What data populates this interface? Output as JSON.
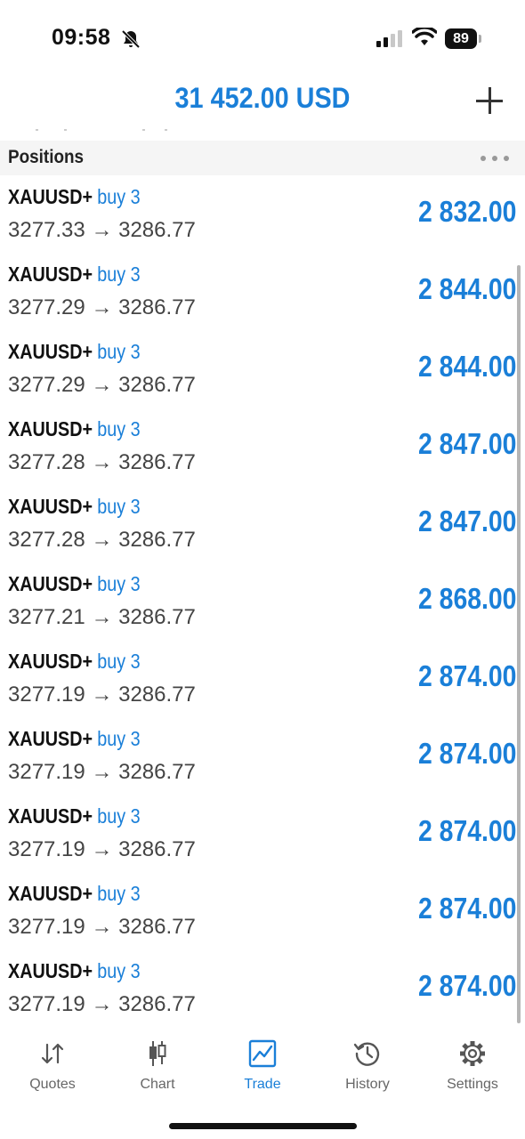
{
  "status_bar": {
    "time": "09:58",
    "battery": "89"
  },
  "header": {
    "balance": "31 452.00 USD",
    "add_icon": "plus-icon"
  },
  "section": {
    "title": "Positions",
    "more_icon": "more-icon"
  },
  "positions": [
    {
      "symbol": "XAUUSD+",
      "direction": "buy 3",
      "open": "3277.33",
      "current": "3286.77",
      "profit": "2 832.00"
    },
    {
      "symbol": "XAUUSD+",
      "direction": "buy 3",
      "open": "3277.29",
      "current": "3286.77",
      "profit": "2 844.00"
    },
    {
      "symbol": "XAUUSD+",
      "direction": "buy 3",
      "open": "3277.29",
      "current": "3286.77",
      "profit": "2 844.00"
    },
    {
      "symbol": "XAUUSD+",
      "direction": "buy 3",
      "open": "3277.28",
      "current": "3286.77",
      "profit": "2 847.00"
    },
    {
      "symbol": "XAUUSD+",
      "direction": "buy 3",
      "open": "3277.28",
      "current": "3286.77",
      "profit": "2 847.00"
    },
    {
      "symbol": "XAUUSD+",
      "direction": "buy 3",
      "open": "3277.21",
      "current": "3286.77",
      "profit": "2 868.00"
    },
    {
      "symbol": "XAUUSD+",
      "direction": "buy 3",
      "open": "3277.19",
      "current": "3286.77",
      "profit": "2 874.00"
    },
    {
      "symbol": "XAUUSD+",
      "direction": "buy 3",
      "open": "3277.19",
      "current": "3286.77",
      "profit": "2 874.00"
    },
    {
      "symbol": "XAUUSD+",
      "direction": "buy 3",
      "open": "3277.19",
      "current": "3286.77",
      "profit": "2 874.00"
    },
    {
      "symbol": "XAUUSD+",
      "direction": "buy 3",
      "open": "3277.19",
      "current": "3286.77",
      "profit": "2 874.00"
    },
    {
      "symbol": "XAUUSD+",
      "direction": "buy 3",
      "open": "3277.19",
      "current": "3286.77",
      "profit": "2 874.00"
    }
  ],
  "arrow": "→",
  "tabs": [
    {
      "label": "Quotes",
      "icon": "quotes-icon",
      "active": false
    },
    {
      "label": "Chart",
      "icon": "chart-icon",
      "active": false
    },
    {
      "label": "Trade",
      "icon": "trade-icon",
      "active": true
    },
    {
      "label": "History",
      "icon": "history-icon",
      "active": false
    },
    {
      "label": "Settings",
      "icon": "settings-icon",
      "active": false
    }
  ],
  "colors": {
    "accent": "#1a7fd8",
    "text": "#111111",
    "secondary": "#444444"
  }
}
